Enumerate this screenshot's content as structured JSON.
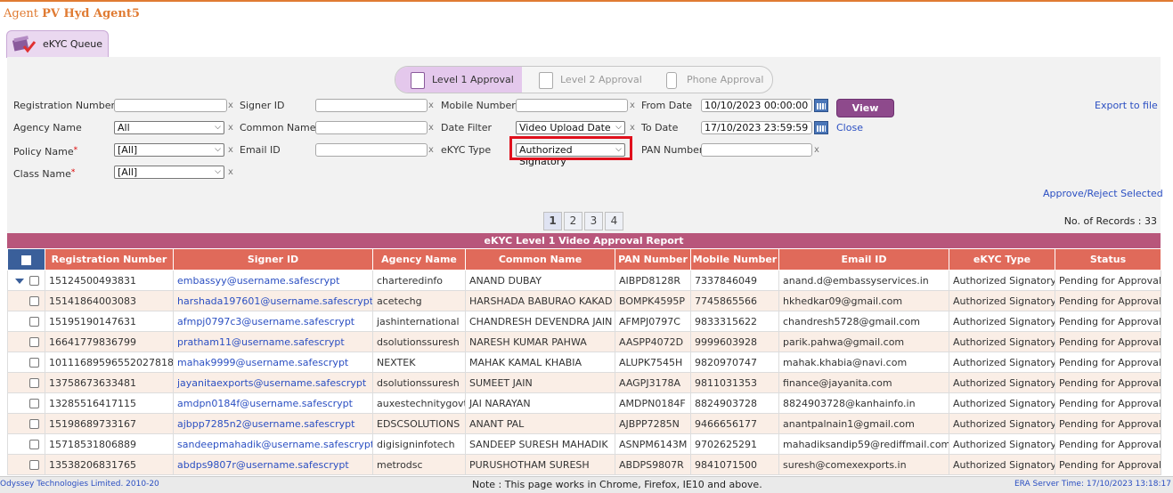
{
  "header": {
    "agent_prefix": "Agent ",
    "agent_name": "PV Hyd Agent5"
  },
  "queue_tab": {
    "label": "eKYC Queue"
  },
  "approval_levels": [
    {
      "label": "Level 1 Approval",
      "active": true
    },
    {
      "label": "Level 2 Approval",
      "active": false
    },
    {
      "label": "Phone Approval",
      "active": false
    }
  ],
  "filters": {
    "registration_number": {
      "label": "Registration Number",
      "value": ""
    },
    "signer_id": {
      "label": "Signer ID",
      "value": ""
    },
    "mobile_number": {
      "label": "Mobile Number",
      "value": ""
    },
    "from_date": {
      "label": "From Date",
      "value": "10/10/2023  00:00:00"
    },
    "agency_name": {
      "label": "Agency Name",
      "value": "All"
    },
    "common_name": {
      "label": "Common Name",
      "value": ""
    },
    "date_filter": {
      "label": "Date Filter",
      "value": "Video Upload Date"
    },
    "to_date": {
      "label": "To Date",
      "value": "17/10/2023  23:59:59"
    },
    "policy_name": {
      "label": "Policy Name",
      "value": "[All]"
    },
    "email_id": {
      "label": "Email ID",
      "value": ""
    },
    "ekyc_type": {
      "label": "eKYC Type",
      "value": "Authorized Signatory"
    },
    "pan_number": {
      "label": "PAN Number",
      "value": ""
    },
    "class_name": {
      "label": "Class Name",
      "value": "[All]"
    },
    "clear_mark": "x",
    "required_mark": "*"
  },
  "actions": {
    "view": "View",
    "close": "Close",
    "export": "Export to file",
    "approve_reject": "Approve/Reject Selected"
  },
  "pagination": {
    "pages": [
      "1",
      "2",
      "3",
      "4"
    ],
    "current": "1",
    "records_text": "No. of Records : 33"
  },
  "report": {
    "title": "eKYC Level 1 Video Approval Report",
    "columns": [
      "Registration Number",
      "Signer ID",
      "Agency Name",
      "Common Name",
      "PAN Number",
      "Mobile Number",
      "Email ID",
      "eKYC Type",
      "Status"
    ],
    "rows": [
      [
        "15124500493831",
        "embassyy@username.safescrypt",
        "charteredinfo",
        "ANAND DUBAY",
        "AIBPD8128R",
        "7337846049",
        "anand.d@embassyservices.in",
        "Authorized Signatory",
        "Pending for Approval"
      ],
      [
        "15141864003083",
        "harshada197601@username.safescrypt",
        "acetechg",
        "HARSHADA BABURAO KAKAD",
        "BOMPK4595P",
        "7745865566",
        "hkhedkar09@gmail.com",
        "Authorized Signatory",
        "Pending for Approval"
      ],
      [
        "15195190147631",
        "afmpj0797c3@username.safescrypt",
        "jashinternational",
        "CHANDRESH DEVENDRA JAIN",
        "AFMPJ0797C",
        "9833315622",
        "chandresh5728@gmail.com",
        "Authorized Signatory",
        "Pending for Approval"
      ],
      [
        "16641779836799",
        "pratham11@username.safescrypt",
        "dsolutionssuresh",
        "NARESH KUMAR PAHWA",
        "AASPP4072D",
        "9999603928",
        "parik.pahwa@gmail.com",
        "Authorized Signatory",
        "Pending for Approval"
      ],
      [
        "10111689596552027818",
        "mahak9999@username.safescrypt",
        "NEXTEK",
        "MAHAK KAMAL KHABIA",
        "ALUPK7545H",
        "9820970747",
        "mahak.khabia@navi.com",
        "Authorized Signatory",
        "Pending for Approval"
      ],
      [
        "13758673633481",
        "jayanitaexports@username.safescrypt",
        "dsolutionssuresh",
        "SUMEET JAIN",
        "AAGPJ3178A",
        "9811031353",
        "finance@jayanita.com",
        "Authorized Signatory",
        "Pending for Approval"
      ],
      [
        "13285516417115",
        "amdpn0184f@username.safescrypt",
        "auxestechnitygovt",
        "JAI NARAYAN",
        "AMDPN0184F",
        "8824903728",
        "8824903728@kanhainfo.in",
        "Authorized Signatory",
        "Pending for Approval"
      ],
      [
        "15198689733167",
        "ajbpp7285n2@username.safescrypt",
        "EDSCSOLUTIONS",
        "ANANT PAL",
        "AJBPP7285N",
        "9466656177",
        "anantpalnain1@gmail.com",
        "Authorized Signatory",
        "Pending for Approval"
      ],
      [
        "15718531806889",
        "sandeepmahadik@username.safescrypt",
        "digisigninfotech",
        "SANDEEP SURESH MAHADIK",
        "ASNPM6143M",
        "9702625291",
        "mahadiksandip59@rediffmail.com",
        "Authorized Signatory",
        "Pending for Approval"
      ],
      [
        "13538206831765",
        "abdps9807r@username.safescrypt",
        "metrodsc",
        "PURUSHOTHAM SURESH",
        "ABDPS9807R",
        "9841071500",
        "suresh@comexexports.in",
        "Authorized Signatory",
        "Pending for Approval"
      ]
    ]
  },
  "footer": {
    "copyright": "Odyssey Technologies Limited. 2010-20",
    "note": "Note : This page works in Chrome, Firefox, IE10 and above.",
    "server_time": "ERA Server Time: 17/10/2023 13:18:17"
  },
  "colors": {
    "accent_orange": "#e07b33",
    "header_red": "#e06a5a",
    "report_bar": "#b8567b",
    "view_button": "#8e4a8c",
    "highlight_box": "#e0101c"
  }
}
